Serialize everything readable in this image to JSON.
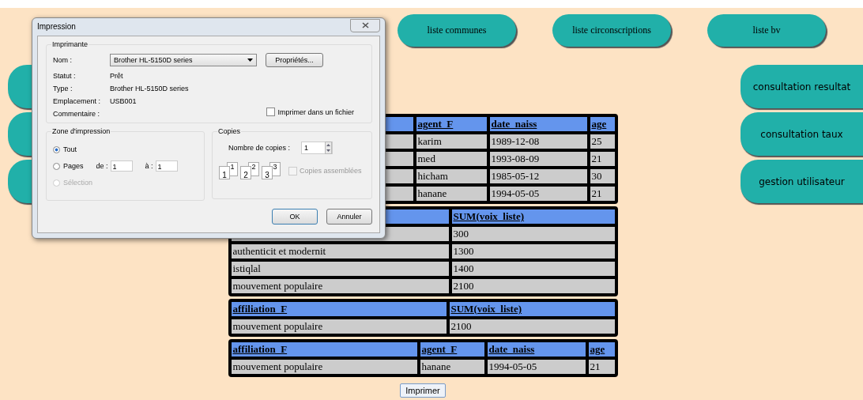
{
  "nav": [
    {
      "label": "liste communes"
    },
    {
      "label": "liste circonscriptions"
    },
    {
      "label": "liste bv"
    }
  ],
  "left_buttons": [
    {
      "kind": "button"
    },
    {
      "kind": "button"
    },
    {
      "kind": "button"
    }
  ],
  "right_buttons": [
    {
      "label": "consultation resultat"
    },
    {
      "label": "consultation taux"
    },
    {
      "label": "gestion utilisateur"
    }
  ],
  "tables": [
    {
      "columns": [
        {
          "kind": "blank"
        },
        {
          "kind": "link",
          "label": "agent_F"
        },
        {
          "kind": "link",
          "label": "date_naiss"
        },
        {
          "kind": "link",
          "label": "age"
        }
      ],
      "rows": [
        [
          null,
          "karim",
          "1989-12-08",
          "25"
        ],
        [
          null,
          "med",
          "1993-08-09",
          "21"
        ],
        [
          null,
          "hicham",
          "1985-05-12",
          "30"
        ],
        [
          null,
          "hanane",
          "1994-05-05",
          "21"
        ]
      ]
    },
    {
      "columns": [
        {
          "kind": "blank"
        },
        {
          "kind": "link",
          "label": "SUM(voix_liste)"
        }
      ],
      "rows": [
        [
          null,
          "300"
        ],
        [
          "authenticit et modernit",
          "1300"
        ],
        [
          "istiqlal",
          "1400"
        ],
        [
          "mouvement populaire",
          "2100"
        ]
      ]
    },
    {
      "columns": [
        {
          "kind": "link",
          "label": "affiliation_F"
        },
        {
          "kind": "link",
          "label": "SUM(voix_liste)"
        }
      ],
      "rows": [
        [
          "mouvement populaire",
          "2100"
        ]
      ]
    },
    {
      "columns": [
        {
          "kind": "link",
          "label": "affiliation_F"
        },
        {
          "kind": "link",
          "label": "agent_F"
        },
        {
          "kind": "link",
          "label": "date_naiss"
        },
        {
          "kind": "link",
          "label": "age"
        }
      ],
      "rows": [
        [
          "mouvement populaire",
          "hanane",
          "1994-05-05",
          "21"
        ]
      ]
    }
  ],
  "print_button": "Imprimer",
  "dialog": {
    "title": "Impression",
    "printer_group": {
      "legend": "Imprimante",
      "fields": [
        {
          "label": "Nom :",
          "kind": "select",
          "value": "Brother HL-5150D series"
        },
        {
          "label": "Statut :",
          "kind": "text",
          "value": "Prêt"
        },
        {
          "label": "Type :",
          "kind": "text",
          "value": "Brother HL-5150D series"
        },
        {
          "label": "Emplacement :",
          "kind": "text",
          "value": "USB001"
        },
        {
          "label": "Commentaire :",
          "kind": "text"
        }
      ],
      "properties_button": "Propriétés...",
      "print_to_file": {
        "label": "Imprimer dans un fichier",
        "checked": false
      }
    },
    "range_group": {
      "legend": "Zone d'impression",
      "options": [
        {
          "label": "Tout",
          "selected": true,
          "disabled": false
        },
        {
          "label": "Pages",
          "selected": false,
          "disabled": false
        },
        {
          "label": "Sélection",
          "selected": false,
          "disabled": true
        }
      ],
      "from_label": "de :",
      "from": "1",
      "to_label": "à :",
      "to": "1"
    },
    "copies_group": {
      "legend": "Copies",
      "count_label": "Nombre de copies :",
      "count": "1",
      "collate_icons": [
        {
          "front": "1",
          "back": "1"
        },
        {
          "front": "2",
          "back": "2"
        },
        {
          "front": "3",
          "back": "3"
        }
      ],
      "collate": {
        "label": "Copies assemblées",
        "checked": false,
        "disabled": true
      }
    },
    "buttons": [
      {
        "label": "OK",
        "kind": "default"
      },
      {
        "label": "Annuler",
        "kind": "normal"
      }
    ]
  }
}
